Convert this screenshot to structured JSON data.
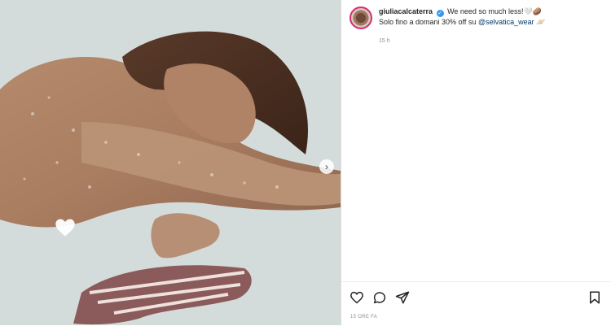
{
  "post": {
    "username": "giuliacalcaterra",
    "verified_badge": "✓",
    "caption_line1": "We need so much less!",
    "caption_line1_emoji": "🤍🥔",
    "caption_line2_prefix": "Solo fino a domani 30% off su",
    "mention": "@selvatica_wear",
    "caption_line2_emoji": "🪐",
    "time_short": "15 h",
    "time_long": "15 ORE FA"
  },
  "media": {
    "next_arrow": "›"
  },
  "icons": [
    "like-heart-icon",
    "comment-icon",
    "share-icon",
    "save-icon",
    "carousel-next-icon"
  ],
  "colors": {
    "verified": "#3897f0",
    "link": "#00376b",
    "muted": "#8e8e8e",
    "text": "#262626",
    "divider": "#dbdbdb"
  }
}
